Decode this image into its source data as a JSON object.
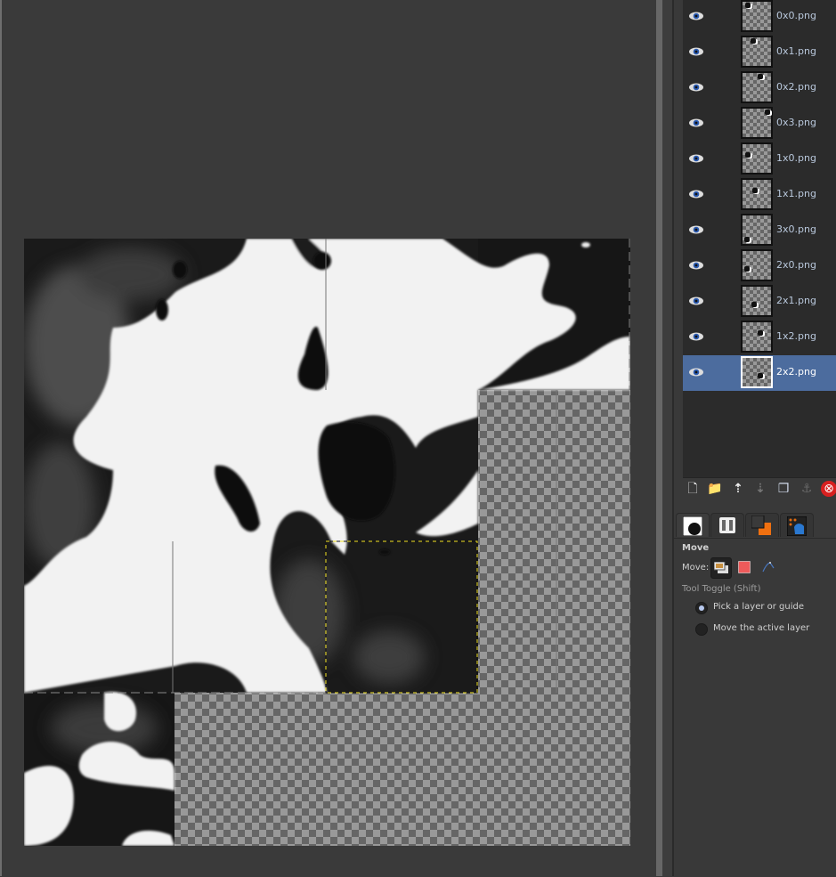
{
  "canvas": {
    "guides": "dashed guide lines and yellow active-layer boundary",
    "active_layer_outline_color": "#f0e020"
  },
  "layers": {
    "items": [
      {
        "name": "0x0.png",
        "visible": true,
        "active": false
      },
      {
        "name": "0x1.png",
        "visible": true,
        "active": false
      },
      {
        "name": "0x2.png",
        "visible": true,
        "active": false
      },
      {
        "name": "0x3.png",
        "visible": true,
        "active": false
      },
      {
        "name": "1x0.png",
        "visible": true,
        "active": false
      },
      {
        "name": "1x1.png",
        "visible": true,
        "active": false
      },
      {
        "name": "3x0.png",
        "visible": true,
        "active": false
      },
      {
        "name": "2x0.png",
        "visible": true,
        "active": false
      },
      {
        "name": "2x1.png",
        "visible": true,
        "active": false
      },
      {
        "name": "1x2.png",
        "visible": true,
        "active": false
      },
      {
        "name": "2x2.png",
        "visible": true,
        "active": true
      }
    ],
    "toolbar": [
      {
        "icon": "new-layer-icon",
        "glyph": "🗋"
      },
      {
        "icon": "new-layer-group-icon",
        "glyph": "📁"
      },
      {
        "icon": "raise-layer-icon",
        "glyph": "⇡"
      },
      {
        "icon": "lower-layer-icon",
        "glyph": "⇣"
      },
      {
        "icon": "duplicate-layer-icon",
        "glyph": "❐"
      },
      {
        "icon": "anchor-layer-icon",
        "glyph": "⚓"
      },
      {
        "icon": "delete-layer-icon",
        "glyph": "⊗"
      }
    ]
  },
  "dock_tabs": [
    {
      "name": "tool-options-tab",
      "active": true
    },
    {
      "name": "device-status-tab",
      "active": false
    },
    {
      "name": "colors-tab",
      "active": false
    },
    {
      "name": "brushes-tab",
      "active": false
    }
  ],
  "tool_options": {
    "title": "Move",
    "move_label": "Move:",
    "modes": [
      "layer",
      "selection",
      "path"
    ],
    "tool_toggle_label": "Tool Toggle  (Shift)",
    "options": [
      {
        "label": "Pick a layer or guide",
        "checked": true
      },
      {
        "label": "Move the active layer",
        "checked": false
      }
    ]
  }
}
